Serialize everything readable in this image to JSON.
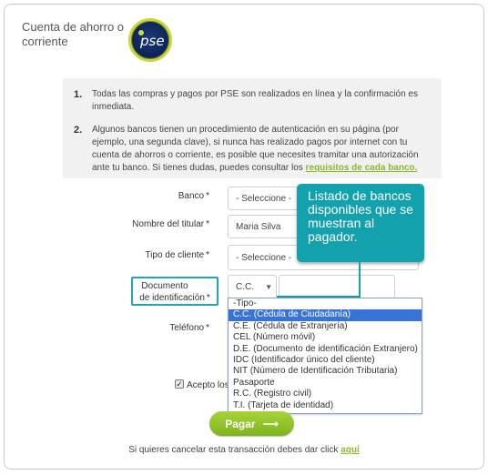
{
  "header": {
    "title": "Cuenta de ahorro o corriente",
    "logo_text": "pse"
  },
  "info": [
    {
      "num": "1.",
      "text": "Todas las compras y pagos por PSE son realizados en línea y la confirmación es inmediata."
    },
    {
      "num": "2.",
      "text": "Algunos bancos tienen un procedimiento de autenticación en su página (por ejemplo, una segunda clave), si nunca has realizado pagos por internet con tu cuenta de ahorros o corriente, es posible que necesites tramitar una autorización ante tu banco. Si tienes dudas, puedes consultar los ",
      "link": "requisitos de cada banco."
    }
  ],
  "form": {
    "banco_label": "Banco",
    "banco_value": "- Seleccione -",
    "titular_label": "Nombre del titular",
    "titular_value": "Maria Silva",
    "tipo_cliente_label": "Tipo de cliente",
    "tipo_cliente_value": "- Seleccione -",
    "documento_label_1": "Documento",
    "documento_label_2": "de identificación",
    "documento_value": "C.C.",
    "telefono_label": "Teléfono",
    "acepto_label": "Acepto los",
    "required_mark": "*"
  },
  "callout": {
    "text": "Listado de bancos disponibles que se muestran al pagador."
  },
  "dropdown": {
    "options": [
      "-Tipo-",
      "C.C. (Cédula de Ciudadanía)",
      "C.E. (Cédula de Extranjería)",
      "CEL (Número móvil)",
      "D.E. (Documento de identificación Extranjero)",
      "IDC (Identificador único del cliente)",
      "NIT (Número de Identificación Tributaria)",
      "Pasaporte",
      "R.C. (Registro civil)",
      "T.I. (Tarjeta de identidad)"
    ],
    "selected": "C.C. (Cédula de Ciudadanía)"
  },
  "actions": {
    "pagar_label": "Pagar",
    "pagar_arrow": "⟶",
    "cancel_text": "Si quieres cancelar esta transacción debes dar click ",
    "cancel_link": "aquí"
  },
  "colors": {
    "accent_teal": "#12a1ad",
    "accent_green": "#8fb72a",
    "selection_blue": "#3874d8"
  }
}
